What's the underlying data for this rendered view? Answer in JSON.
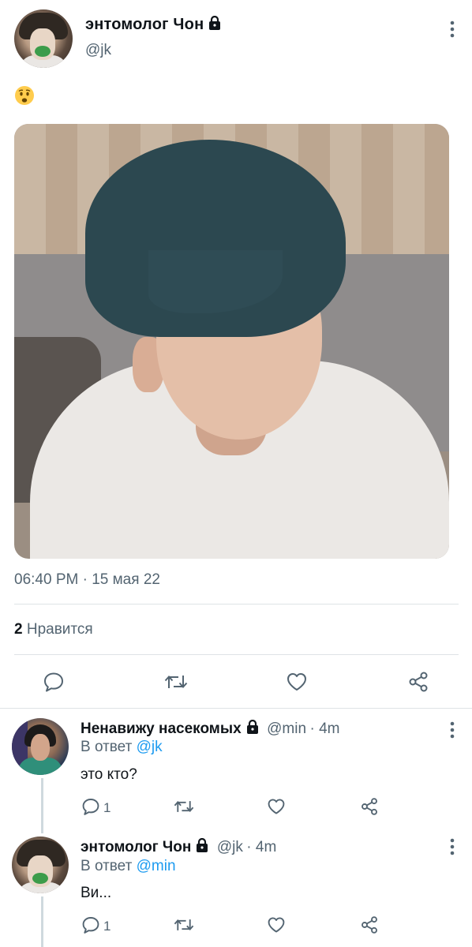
{
  "tweet": {
    "display_name": "энтомолог Чон",
    "handle": "@jk",
    "emoji": "😟",
    "timestamp": "06:40 PM · 15 мая 22",
    "likes_count": "2",
    "likes_label": "Нравится",
    "icons": [
      "reply-icon",
      "retweet-icon",
      "like-icon",
      "share-icon"
    ]
  },
  "replies": [
    {
      "display_name": "Ненавижу насекомых",
      "handle": "@min",
      "time": "· 4m",
      "reply_to_prefix": "В ответ",
      "reply_to_handle": "@jk",
      "text": "это кто?",
      "reply_count": "1"
    },
    {
      "display_name": "энтомолог Чон",
      "handle": "@jk",
      "time": "· 4m",
      "reply_to_prefix": "В ответ",
      "reply_to_handle": "@min",
      "text": "Ви...",
      "reply_count": "1"
    }
  ],
  "colors": {
    "text": "#0f1419",
    "secondary": "#536471",
    "link": "#1d9bf0",
    "divider": "#dfe3e6"
  }
}
